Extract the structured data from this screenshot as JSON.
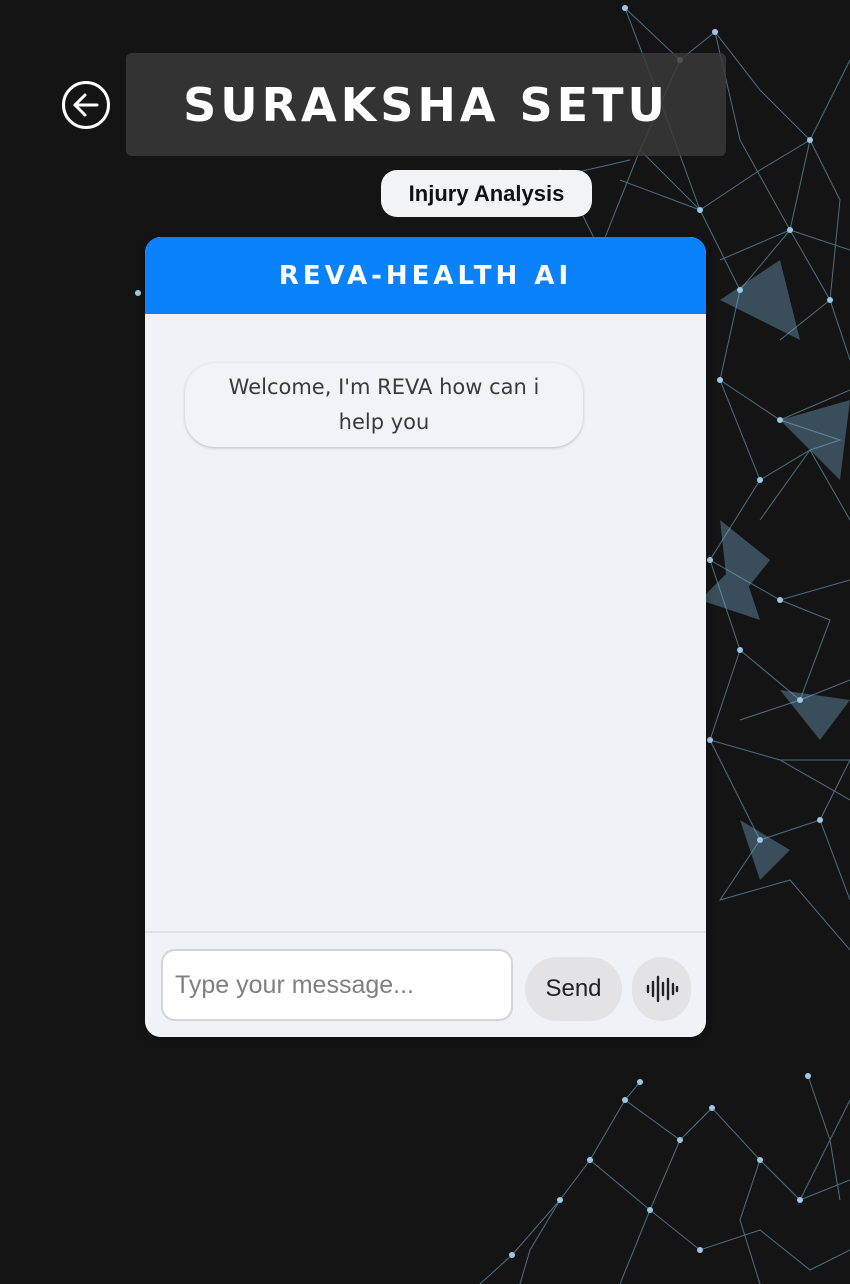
{
  "header": {
    "back_icon": "arrow-left-circle-icon",
    "title": "SURAKSHA SETU",
    "mode_label": "Injury Analysis"
  },
  "chat": {
    "header_title": "REVA-HEALTH AI",
    "messages": [
      {
        "sender": "bot",
        "text": "Welcome, I'm REVA how can i help you"
      }
    ],
    "input": {
      "value": "",
      "placeholder": "Type your message..."
    },
    "send_label": "Send",
    "voice_icon": "audio-waveform-icon"
  },
  "colors": {
    "background": "#141414",
    "accent": "#0a82fb",
    "panel": "#eff3f8",
    "network_lines": "#7fb8dc"
  }
}
